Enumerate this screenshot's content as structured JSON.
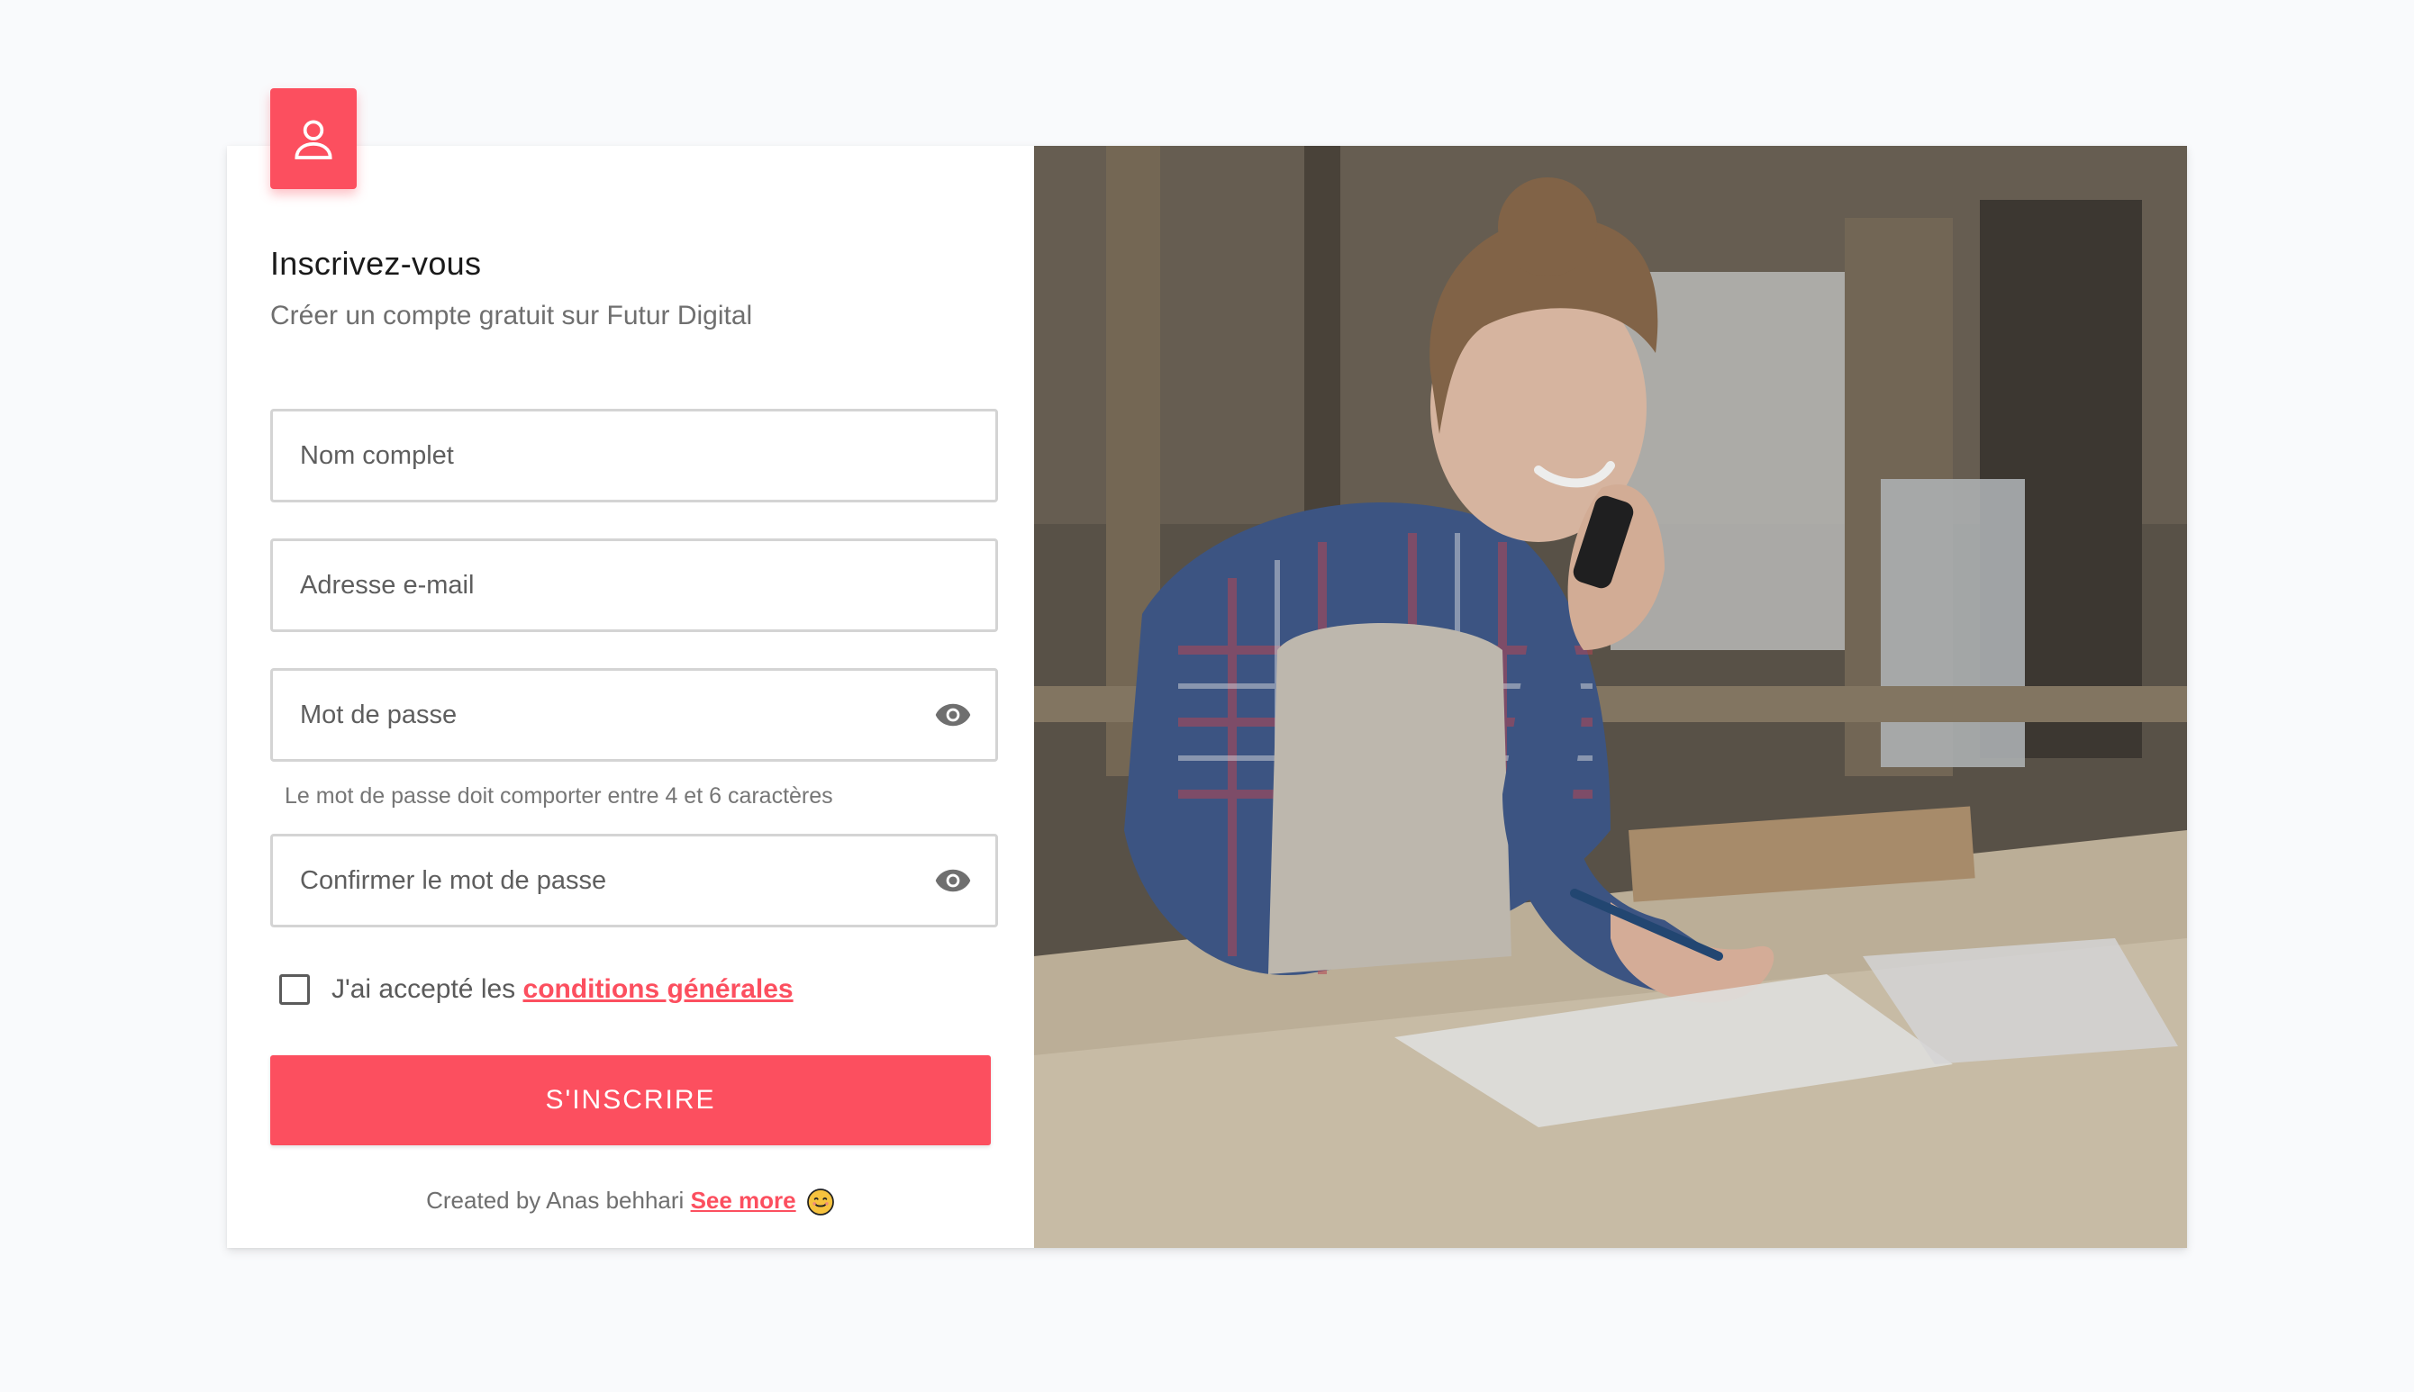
{
  "signup": {
    "title": "Inscrivez-vous",
    "subtitle": "Créer un compte gratuit sur Futur Digital",
    "fields": {
      "name_placeholder": "Nom complet",
      "email_placeholder": "Adresse e-mail",
      "password_placeholder": "Mot de passe",
      "confirm_placeholder": "Confirmer le mot de passe"
    },
    "password_hint": "Le mot de passe doit comporter entre 4 et 6 caractères",
    "terms_prefix": "J'ai accepté les",
    "terms_link": "conditions générales",
    "submit_label": "S'INSCRIRE",
    "footer_prefix": "Created by Anas behhari",
    "footer_link": "See more",
    "icons": {
      "avatar": "user-icon",
      "password_toggle": "eye-icon",
      "emoji": "smile-icon"
    }
  },
  "colors": {
    "accent": "#fc4f5f",
    "background": "#f9fafc"
  }
}
